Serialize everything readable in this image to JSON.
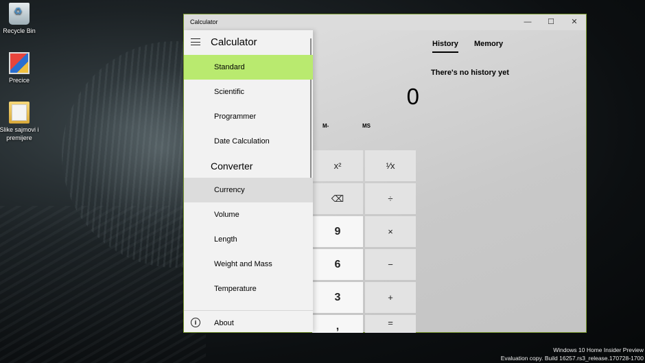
{
  "desktop": {
    "icons": [
      {
        "label": "Recycle Bin",
        "icon": "recycle-bin-icon"
      },
      {
        "label": "Precice",
        "icon": "app-shortcut-icon"
      },
      {
        "label": "Slike sajmovi i premijere",
        "icon": "folder-icon"
      }
    ],
    "watermark_line1": "Windows 10 Home Insider Preview",
    "watermark_line2": "Evaluation copy. Build 16257.rs3_release.170728-1700"
  },
  "window": {
    "title": "Calculator",
    "controls": {
      "minimize": "—",
      "maximize": "☐",
      "close": "✕"
    },
    "accent": "#b9ea6f"
  },
  "nav": {
    "title": "Calculator",
    "calculator_items": [
      "Standard",
      "Scientific",
      "Programmer",
      "Date Calculation"
    ],
    "selected": "Standard",
    "converter_heading": "Converter",
    "converter_items": [
      "Currency",
      "Volume",
      "Length",
      "Weight and Mass",
      "Temperature"
    ],
    "hovered": "Currency",
    "about": "About"
  },
  "calc": {
    "display": "0",
    "memory": {
      "mminus": "M-",
      "ms": "MS"
    },
    "keys": {
      "square": "x²",
      "reciprocal": "¹⁄x",
      "backspace": "⌫",
      "divide": "÷",
      "nine": "9",
      "multiply": "×",
      "six": "6",
      "minus": "−",
      "three": "3",
      "plus": "+",
      "decimal": ",",
      "equals": "="
    }
  },
  "history": {
    "tab_history": "History",
    "tab_memory": "Memory",
    "empty_text": "There's no history yet"
  }
}
